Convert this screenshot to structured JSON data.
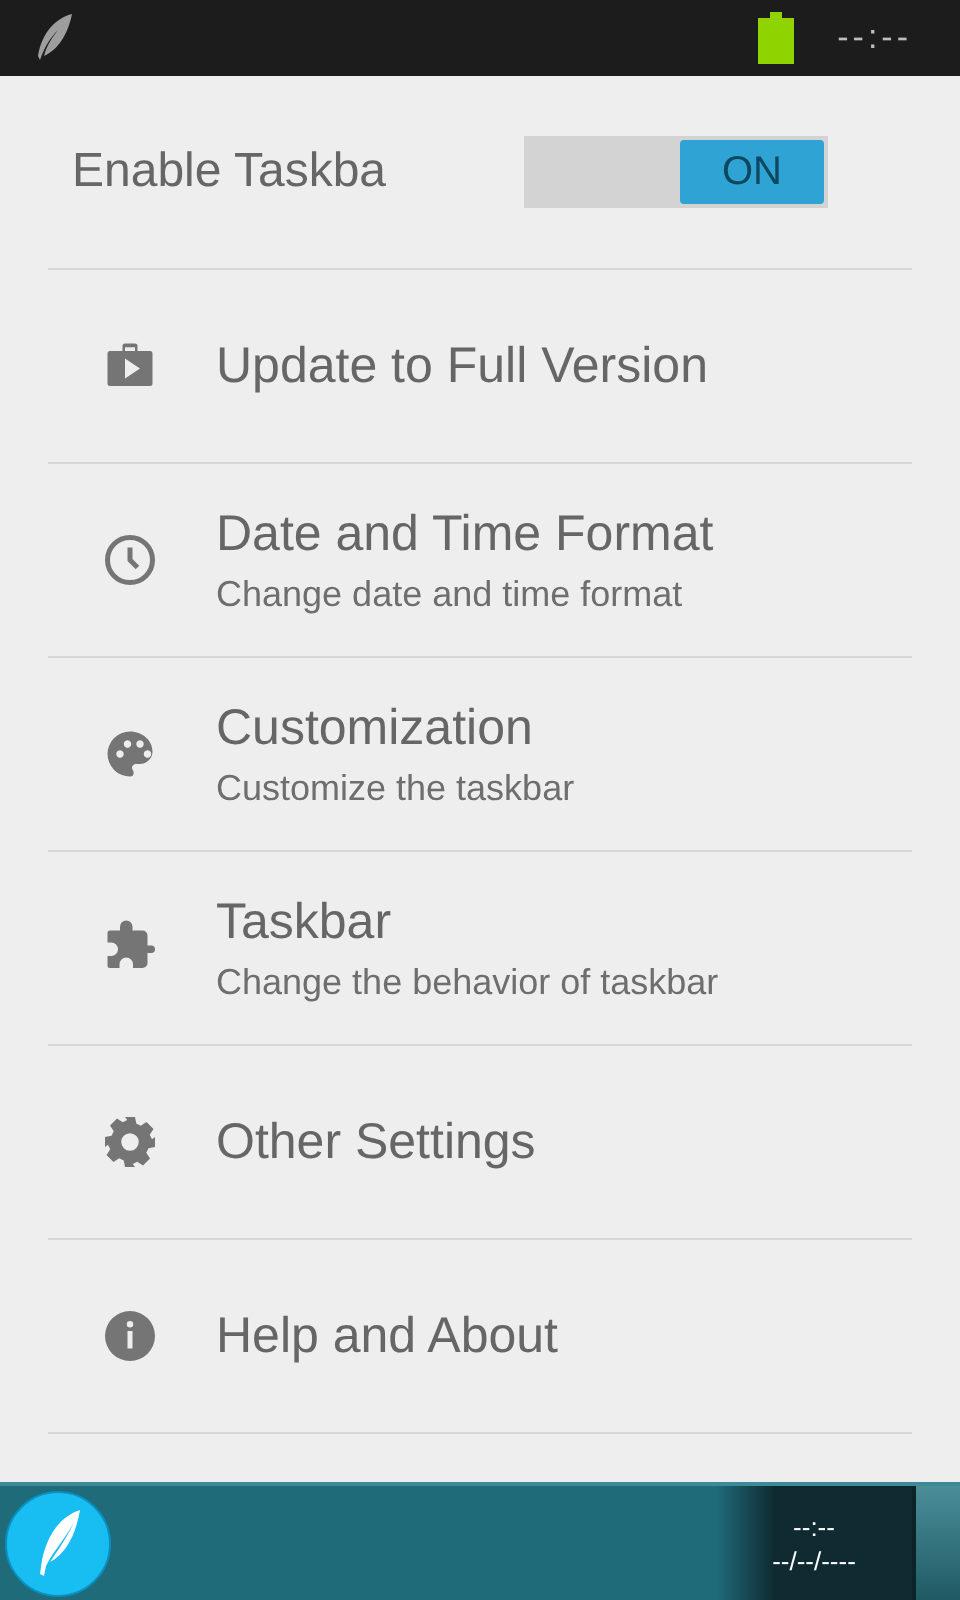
{
  "status_bar": {
    "time": "--:--"
  },
  "enable_row": {
    "label": "Enable Taskba",
    "switch": {
      "on": true,
      "label": "ON"
    }
  },
  "items": [
    {
      "title": "Update to Full Version"
    },
    {
      "title": "Date and Time Format",
      "subtitle": "Change date and time format"
    },
    {
      "title": "Customization",
      "subtitle": "Customize the taskbar"
    },
    {
      "title": "Taskbar",
      "subtitle": "Change the behavior of taskbar"
    },
    {
      "title": "Other Settings"
    },
    {
      "title": "Help and About"
    }
  ],
  "taskbar": {
    "time": "--:--",
    "date": "--/--/----"
  }
}
